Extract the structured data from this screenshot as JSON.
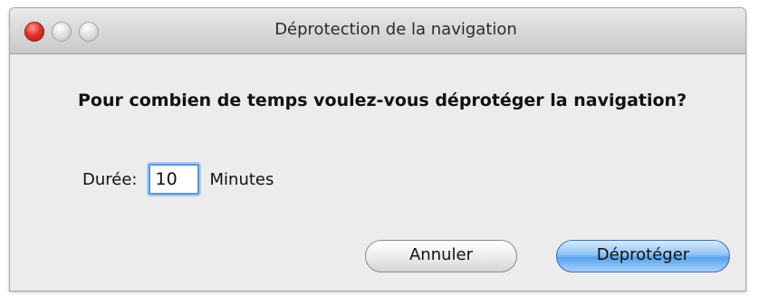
{
  "window": {
    "title": "Déprotection de la navigation"
  },
  "dialog": {
    "question": "Pour combien de temps voulez-vous déprotéger la navigation?",
    "duration_label": "Durée:",
    "duration_value": "10",
    "duration_unit": "Minutes"
  },
  "buttons": {
    "cancel_label": "Annuler",
    "confirm_label": "Déprotéger"
  }
}
